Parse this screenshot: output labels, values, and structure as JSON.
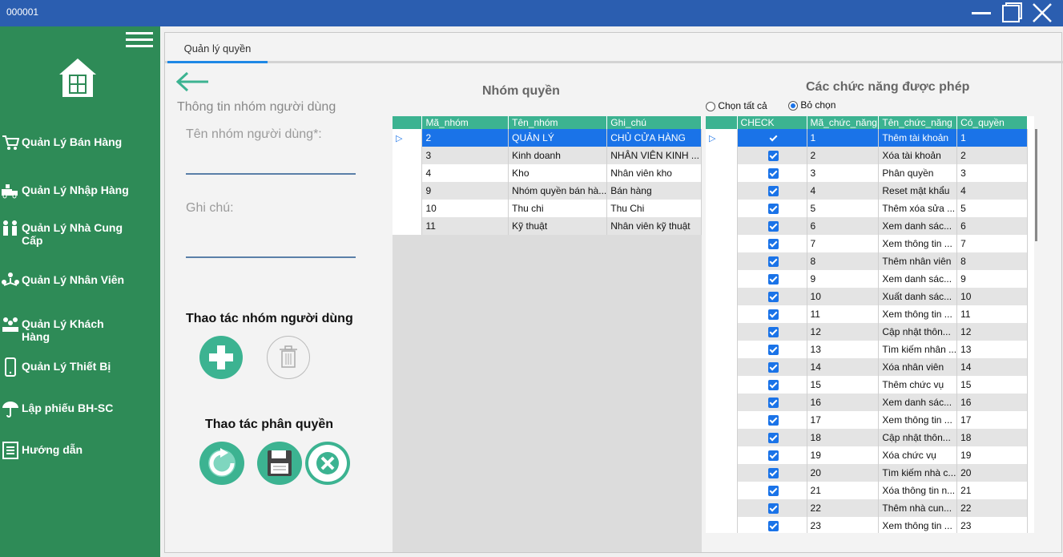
{
  "window": {
    "title": "000001"
  },
  "sidebar": {
    "items": [
      {
        "label": "Quản Lý Bán Hàng",
        "icon": "cart-icon"
      },
      {
        "label": "Quản Lý Nhập Hàng",
        "icon": "truck-icon"
      },
      {
        "label": "Quản Lý Nhà Cung Cấp",
        "icon": "suppliers-icon"
      },
      {
        "label": "Quản Lý Nhân Viên",
        "icon": "employees-icon"
      },
      {
        "label": "Quản Lý Khách Hàng",
        "icon": "customers-icon"
      },
      {
        "label": "Quản Lý Thiết Bị",
        "icon": "device-icon"
      },
      {
        "label": "Lập phiếu BH-SC",
        "icon": "umbrella-icon"
      },
      {
        "label": "Hướng dẫn",
        "icon": "guide-icon"
      }
    ]
  },
  "tab": {
    "label": "Quản lý quyền"
  },
  "form": {
    "section_title": "Thông tin nhóm người dùng",
    "name_label": "Tên nhóm người dùng*:",
    "note_label": "Ghi chú:",
    "group_actions_title": "Thao tác nhóm người dùng",
    "perm_actions_title": "Thao tác phân quyền"
  },
  "groups": {
    "title": "Nhóm quyền",
    "columns": [
      "Mã_nhóm",
      "Tên_nhóm",
      "Ghi_chú"
    ],
    "rows": [
      [
        "2",
        "QUẢN LÝ",
        "CHỦ CỬA HÀNG"
      ],
      [
        "3",
        "Kinh doanh",
        "NHÂN VIÊN KINH ..."
      ],
      [
        "4",
        "Kho",
        "Nhân viên kho"
      ],
      [
        "9",
        "Nhóm quyền bán hà...",
        "Bán hàng"
      ],
      [
        "10",
        "Thu chi",
        "Thu Chi"
      ],
      [
        "11",
        "Kỹ thuật",
        "Nhân viên kỹ thuật"
      ]
    ]
  },
  "functions": {
    "title": "Các chức năng được phép",
    "select_all_label": "Chọn tất cả",
    "deselect_label": "Bỏ chọn",
    "columns": [
      "CHECK",
      "Mã_chức_năng",
      "Tên_chức_năng",
      "Có_quyền"
    ],
    "rows": [
      [
        "1",
        "Thêm tài khoản",
        "1"
      ],
      [
        "2",
        "Xóa tài khoản",
        "2"
      ],
      [
        "3",
        "Phân quyền",
        "3"
      ],
      [
        "4",
        "Reset mật khẩu",
        "4"
      ],
      [
        "5",
        "Thêm xóa sửa ...",
        "5"
      ],
      [
        "6",
        "Xem danh sác...",
        "6"
      ],
      [
        "7",
        "Xem thông tin ...",
        "7"
      ],
      [
        "8",
        "Thêm nhân viên",
        "8"
      ],
      [
        "9",
        "Xem danh sác...",
        "9"
      ],
      [
        "10",
        "Xuất danh sác...",
        "10"
      ],
      [
        "11",
        "Xem thông tin ...",
        "11"
      ],
      [
        "12",
        "Cập nhật thôn...",
        "12"
      ],
      [
        "13",
        "Tìm kiếm nhân ...",
        "13"
      ],
      [
        "14",
        "Xóa nhân viên",
        "14"
      ],
      [
        "15",
        "Thêm chức vụ",
        "15"
      ],
      [
        "16",
        "Xem danh sác...",
        "16"
      ],
      [
        "17",
        "Xem thông tin ...",
        "17"
      ],
      [
        "18",
        "Cập nhật thôn...",
        "18"
      ],
      [
        "19",
        "Xóa chức vụ",
        "19"
      ],
      [
        "20",
        "Tìm kiếm nhà c...",
        "20"
      ],
      [
        "21",
        "Xóa thông tin n...",
        "21"
      ],
      [
        "22",
        "Thêm nhà cun...",
        "22"
      ],
      [
        "23",
        "Xem thông tin ...",
        "23"
      ]
    ]
  },
  "colors": {
    "sidebar": "#2e8b57",
    "header": "#3cb391",
    "titlebar": "#2b5eb0",
    "selection": "#1a73e8"
  }
}
